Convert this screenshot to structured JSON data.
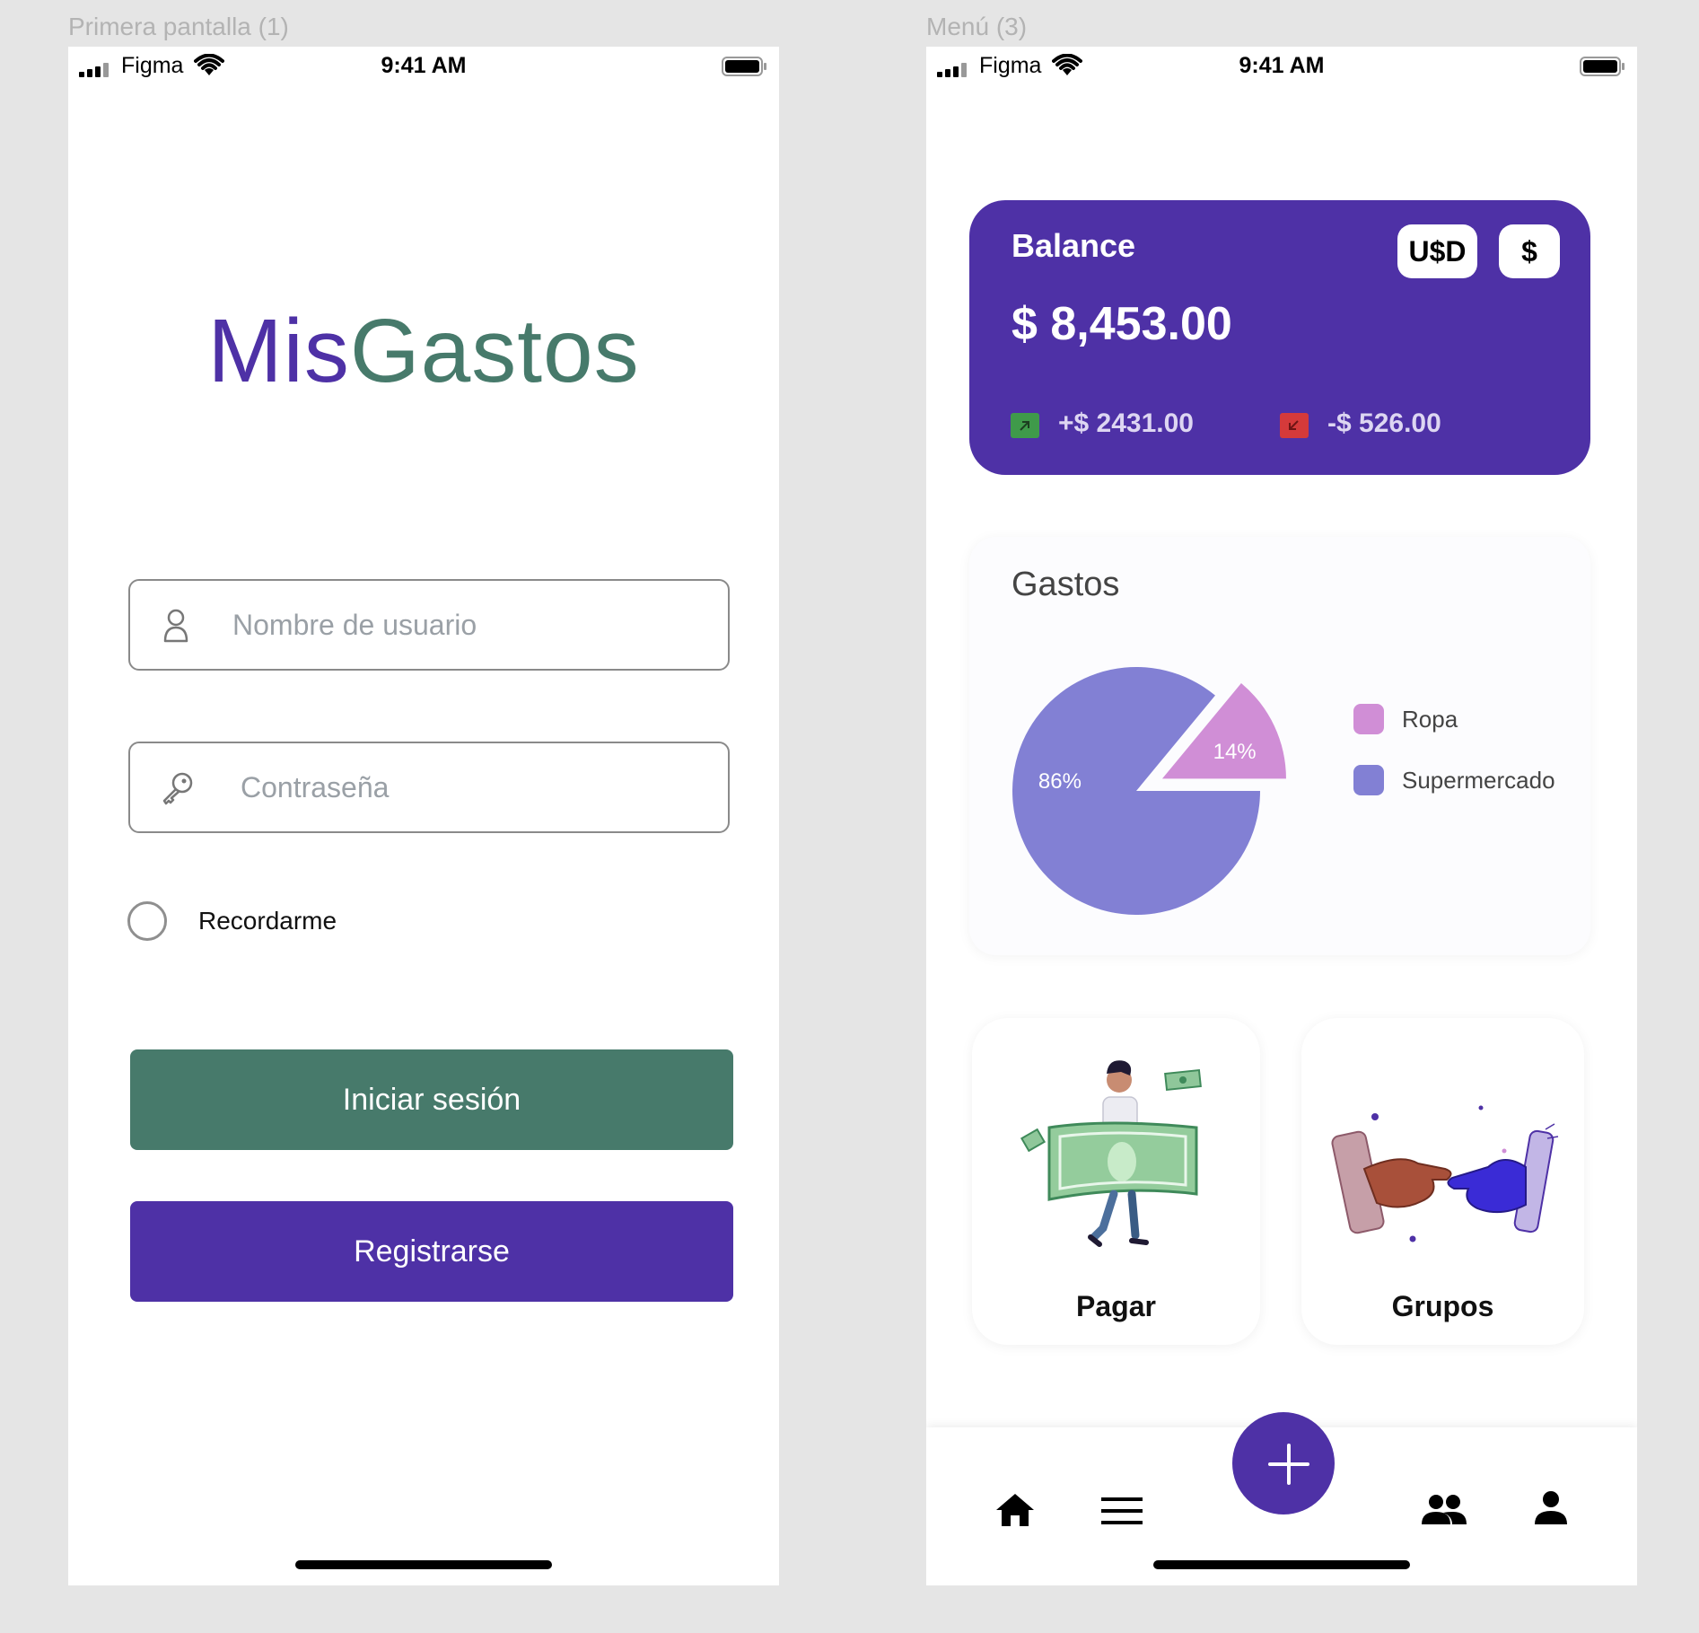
{
  "frames": {
    "login_label": "Primera pantalla (1)",
    "menu_label": "Menú (3)"
  },
  "status_bar": {
    "carrier": "Figma",
    "time": "9:41 AM"
  },
  "login": {
    "logo_part1": "Mis",
    "logo_part2": "Gastos",
    "username_placeholder": "Nombre de usuario",
    "password_placeholder": "Contraseña",
    "remember_label": "Recordarme",
    "login_button": "Iniciar sesión",
    "register_button": "Registrarse"
  },
  "menu": {
    "balance": {
      "title": "Balance",
      "amount": "$ 8,453.00",
      "currency_usd": "U$D",
      "currency_local": "$",
      "income": "+$ 2431.00",
      "expense": "-$ 526.00"
    },
    "gastos_title": "Gastos",
    "tiles": {
      "pay": "Pagar",
      "groups": "Grupos"
    },
    "nav_icons": [
      "home-icon",
      "menu-icon",
      "add-icon",
      "groups-icon",
      "profile-icon"
    ]
  },
  "colors": {
    "purple": "#4e31a6",
    "green": "#477a6b",
    "ropa": "#d08ed6",
    "supermercado": "#8280d4"
  },
  "chart_data": {
    "type": "pie",
    "title": "Gastos",
    "categories": [
      "Ropa",
      "Supermercado"
    ],
    "values": [
      14,
      86
    ],
    "labels": [
      "14%",
      "86%"
    ],
    "colors": [
      "#d08ed6",
      "#8280d4"
    ],
    "legend": "right"
  }
}
